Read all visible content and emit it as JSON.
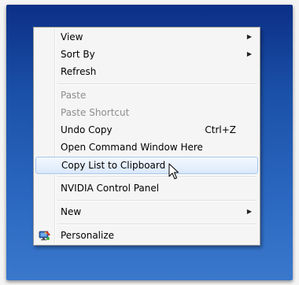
{
  "menu": {
    "items": [
      {
        "label": "View",
        "submenu": true
      },
      {
        "label": "Sort By",
        "submenu": true
      },
      {
        "label": "Refresh"
      },
      {
        "label": "Paste",
        "disabled": true
      },
      {
        "label": "Paste Shortcut",
        "disabled": true
      },
      {
        "label": "Undo Copy",
        "shortcut": "Ctrl+Z"
      },
      {
        "label": "Open Command Window Here"
      },
      {
        "label": "Copy List to Clipboard",
        "highlighted": true
      },
      {
        "label": "NVIDIA Control Panel"
      },
      {
        "label": "New",
        "submenu": true
      },
      {
        "label": "Personalize",
        "icon": "personalize-icon"
      }
    ]
  },
  "colors": {
    "desktop_top": "#0b2f86",
    "desktop_bottom": "#3a78cc",
    "menu_bg": "#f5f5f5",
    "highlight_border": "#a8c8ec",
    "disabled_text": "#8d8d8d"
  }
}
